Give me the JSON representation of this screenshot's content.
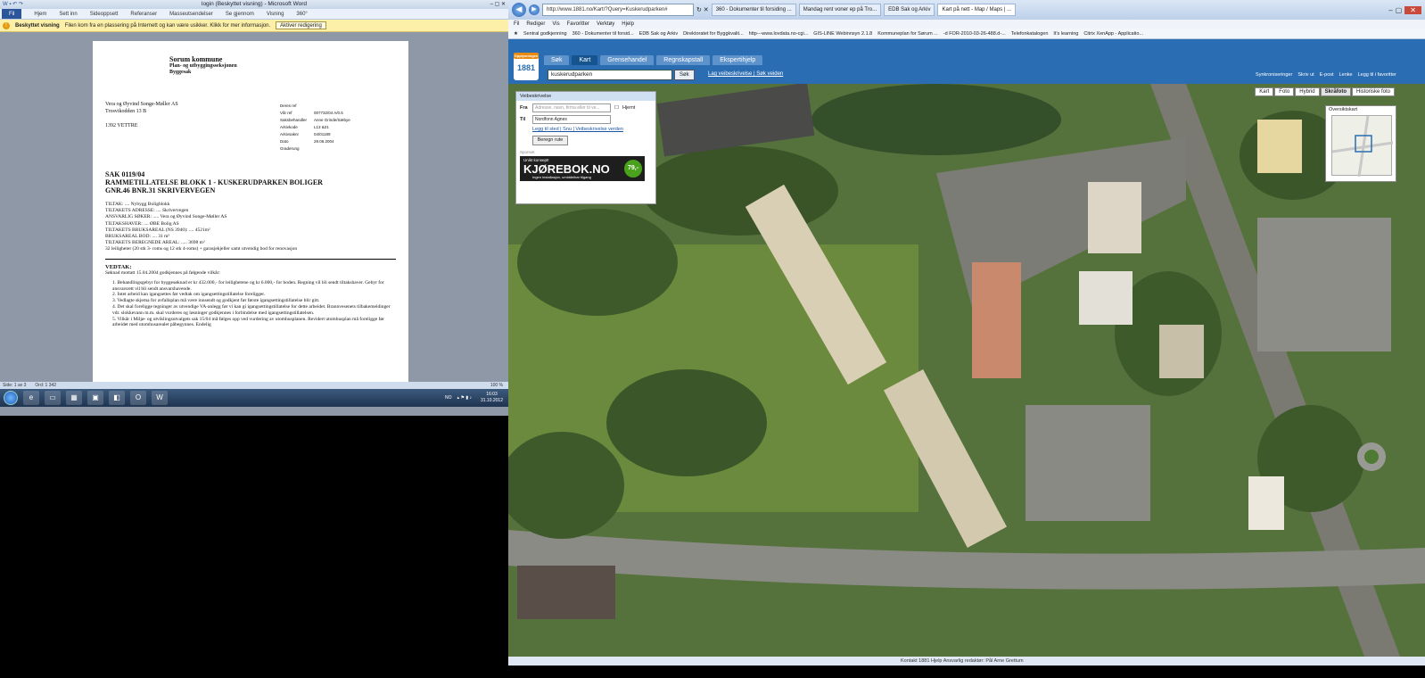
{
  "word": {
    "title": "login (Beskyttet visning) - Microsoft Word",
    "tabs": [
      "Fil",
      "Hjem",
      "Sett inn",
      "Sideoppsett",
      "Referanser",
      "Masseutsendelser",
      "Se gjennom",
      "Visning",
      "360°"
    ],
    "protected_title": "Beskyttet visning",
    "protected_msg": "Filen kom fra en plassering på Internett og kan være usikker. Klikk for mer informasjon.",
    "protected_btn": "Aktiver redigering",
    "status_page": "Side: 1 av 3",
    "status_words": "Ord: 1 342",
    "status_zoom": "100 %",
    "doc": {
      "org": "Sorum kommune",
      "dept": "Plan- og utbyggingsseksjonen",
      "unit": "Byggesak",
      "addr1": "Vera og Øyvind Songe-Møller AS",
      "addr2": "Trosvikodden 13 B",
      "addr3": "1392 VETTRE",
      "meta": [
        [
          "Deres ref",
          ""
        ],
        [
          "Vår ref",
          "007732/04 A/0.5"
        ],
        [
          "Saksbehandler",
          "Anne Grinde/Sæbye"
        ],
        [
          "Arkivkode",
          "L13 &21"
        ],
        [
          "Arkivsaknr",
          "04/01189"
        ],
        [
          "Dato",
          "29.06.2004"
        ],
        [
          "Graderung",
          ""
        ]
      ],
      "sak1": "SAK   0119/04",
      "sak2": "RAMMETILLATELSE BLOKK 1 -  KUSKERUDPARKEN BOLIGER",
      "sak3": "GNR.46 BNR.31 SKRIVERVEGEN",
      "props": [
        "TILTAK: .... Nybygg Boligblokk",
        "TILTAKETS ADRESSE: .... Skrivervegen",
        "ANSVARLIG SØKER: ..... Vera og Øyvind Songe-Møller AS",
        "TILTAKSHAVER: .... ØBE Bolig AS",
        "TILTAKETS BRUKSAREAL (NS 3940): .... 4521m²",
        "BRUKSAREAL BOD: .... 31 m²",
        "TILTAKETS BEREGNEDE AREAL: ..... 3698 m²",
        "32 leiligheter (20 stk 3- roms og 12 stk 4-roms) + garasjekjeller samt utvendig bod for renovasjon"
      ],
      "vedtak": "VEDTAK:",
      "vedtak_sub": "Søknad mottatt 15.04.2004 godkjennes på følgende vilkår:",
      "conditions": [
        "1.  Behandlingsgebyr for byggesøknad er kr 432.000,- for leilighetene og kr 6.000,- for boden. Regning vil bli sendt tiltakshaver. Gebyr for ansvarsrett vil bli sendt ansvarshavende.",
        "2.  Intet arbeid kan igangsettes før vedtak om igangsettingstillatelse foreligger.",
        "3.  Vedlagte skjema for avfallsplan må være innsendt og godkjent før første igangsettingstillatelse blir gitt.",
        "4.  Det skal foreligge tegninger av utvendige VA-anlegg før vi kan gi igangsettingstillatelse for dette arbeidet. Brannvesenets tilbakemeldinger vdr. slokkevann m.m. skal vurderes og løsninger godkjennes i forbindelse med igangsettingstillatelsen.",
        "5.  Vilkår i Miljø- og utviklingsutvalgets sak 15/04 må følges opp ved vurdering av utomhusplanen. Revidert utomhusplan må foreligge før arbeidet med utomhusarealet påbegynnes. Endelig"
      ]
    }
  },
  "taskbar": {
    "lang": "NO",
    "time": "16:03",
    "date": "31.10.2012"
  },
  "browser": {
    "url": "http://www.1881.no/Kart/?Query=Kuskerudparken#",
    "tabs": [
      "360 - Dokumenter til forsiding ...",
      "Mandag rent voner ep på Tro...",
      "EDB Sak og Arkiv",
      "Kart på nett - Map / Maps | ..."
    ],
    "menu": [
      "Fil",
      "Rediger",
      "Vis",
      "Favoritter",
      "Verktøy",
      "Hjelp"
    ],
    "favorites": [
      "Sentral godkjenning",
      "360 - Dokumenter til forsid...",
      "EDB Sak og Arkiv",
      "Direktoratet for Byggkvalit...",
      "http---www.lovdata.no-cgi...",
      "GIS-LINE Webinnsyn 2.1.8",
      "Kommuneplan for Sørum ...",
      "-d FOR-2010-03-26-488.d-...",
      "Telefonkatalogen",
      "It's learning",
      "Citrix XenApp - Applicatio..."
    ],
    "status": "Kontakt 1881   Hjelp   Ansvarlig redaktør: Pål Arne Grettum"
  },
  "site": {
    "logo_top": "Opplysningen",
    "logo": "1881",
    "tabs": [
      "Søk",
      "Kart",
      "Grensehandel",
      "Regnskapstall",
      "Ekspertihjelp"
    ],
    "active_tab": "Kart",
    "search_value": "kuskerudparken",
    "search_btn": "Søk",
    "search_links": "Lag veibeskrivelse | Søk veiden",
    "toplinks": [
      "Synkroniseringer",
      "Skriv ut",
      "E-post",
      "Lenke",
      "Legg til i favoritter"
    ],
    "map_modes": [
      "Kart",
      "Foto",
      "Hybrid",
      "Skråfoto",
      "Historiske foto"
    ],
    "map_mode_active": "Skråfoto",
    "overview_title": "Oversiktskart",
    "route": {
      "title": "Veibeskrivelse",
      "from_label": "Fra",
      "from_placeholder": "Adresse, navn, firma eller til ve...",
      "via_label": "Hjemt",
      "to_label": "Til",
      "to_value": "Nordfonn Agnes",
      "links": "Legg til sted | Snu | Veibeskrivelse verden",
      "button": "Beregn rute",
      "sponsor": "Sponset"
    },
    "ad": {
      "line1": "Unikt konsept!",
      "brand": "KJØREBOK.NO",
      "line3": "Ingen installasjon, umiddelbar tilgang",
      "price": "79,-"
    }
  }
}
